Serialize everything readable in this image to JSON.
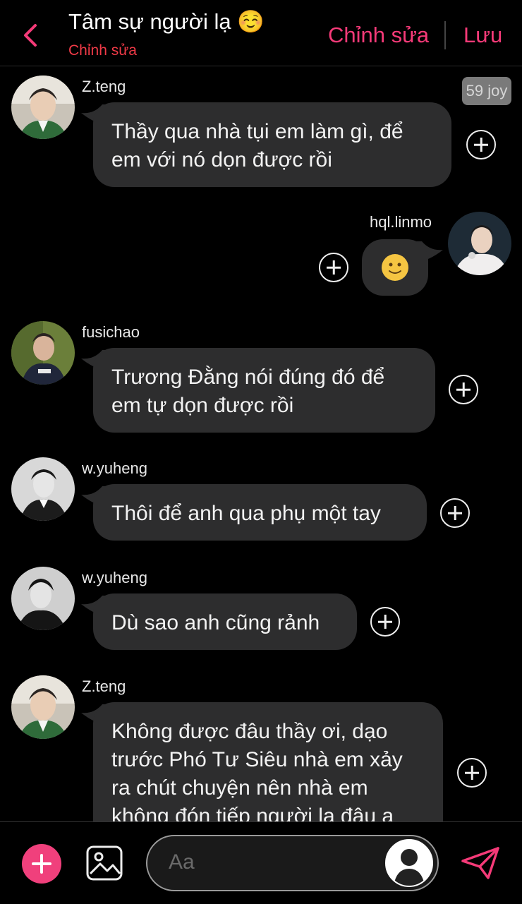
{
  "header": {
    "title": "Tâm sự người lạ ☺️",
    "subtitle": "Chỉnh sửa",
    "edit_label": "Chỉnh sửa",
    "save_label": "Lưu"
  },
  "badge": "59 joy",
  "messages": [
    {
      "sender": "Z.teng",
      "text": "Thầy qua nhà tụi em làm gì, để em với nó dọn được rồi",
      "side": "left"
    },
    {
      "sender": "hql.linmo",
      "text": "🙂",
      "side": "right"
    },
    {
      "sender": "fusichao",
      "text": "Trương Đằng nói đúng đó để em tự dọn được rồi",
      "side": "left"
    },
    {
      "sender": "w.yuheng",
      "text": "Thôi để anh qua phụ một tay",
      "side": "left"
    },
    {
      "sender": "w.yuheng",
      "text": "Dù sao anh cũng rảnh",
      "side": "left"
    },
    {
      "sender": "Z.teng",
      "text": "Không được đâu thầy ơi, dạo trước Phó Tư Siêu nhà em xảy ra chút chuyện nên nhà em không đón tiếp người lạ đâu ạ",
      "side": "left"
    }
  ],
  "composer": {
    "placeholder": "Aa"
  },
  "colors": {
    "accent": "#f53a78",
    "bubble": "#2d2d2e",
    "background": "#000000"
  },
  "icons": [
    "back-chevron-icon",
    "plus-icon",
    "image-icon",
    "send-icon",
    "add-icon"
  ]
}
